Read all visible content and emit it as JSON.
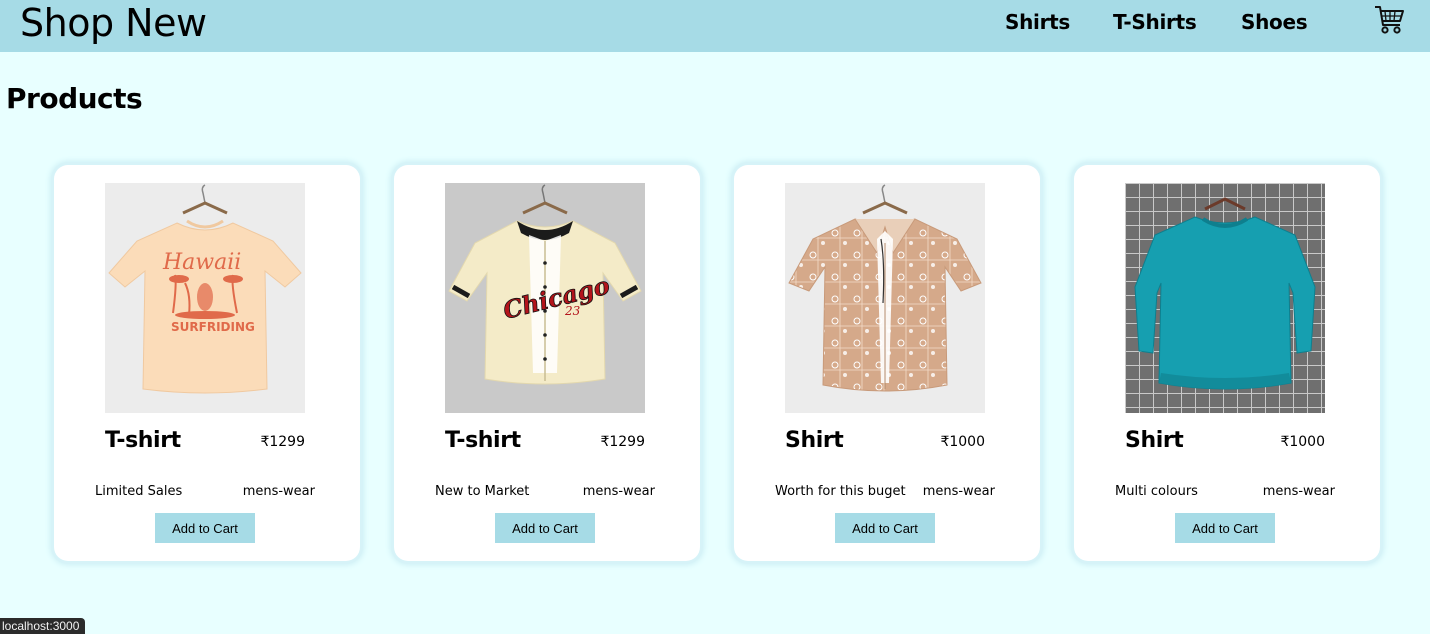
{
  "header": {
    "brand": "Shop New",
    "nav": [
      "Shirts",
      "T-Shirts",
      "Shoes"
    ],
    "cart_icon": "shopping-cart-icon",
    "background_color": "#a6dbe6"
  },
  "main": {
    "title": "Products",
    "background_color": "#e8ffff",
    "products": [
      {
        "name": "T-shirt",
        "price": "₹1299",
        "description": "Limited Sales",
        "category": "mens-wear",
        "button": "Add to Cart",
        "image": "peach Hawaii surfriding t-shirt"
      },
      {
        "name": "T-shirt",
        "price": "₹1299",
        "description": "New to Market",
        "category": "mens-wear",
        "button": "Add to Cart",
        "image": "cream Chicago 23 baseball jersey"
      },
      {
        "name": "Shirt",
        "price": "₹1000",
        "description": "Worth for this buget",
        "category": "mens-wear",
        "button": "Add to Cart",
        "image": "tan paisley bandana print shirt"
      },
      {
        "name": "Shirt",
        "price": "₹1000",
        "description": "Multi colours",
        "category": "mens-wear",
        "button": "Add to Cart",
        "image": "teal crewneck sweatshirt"
      }
    ]
  },
  "status_bar": {
    "url": "localhost:3000"
  }
}
